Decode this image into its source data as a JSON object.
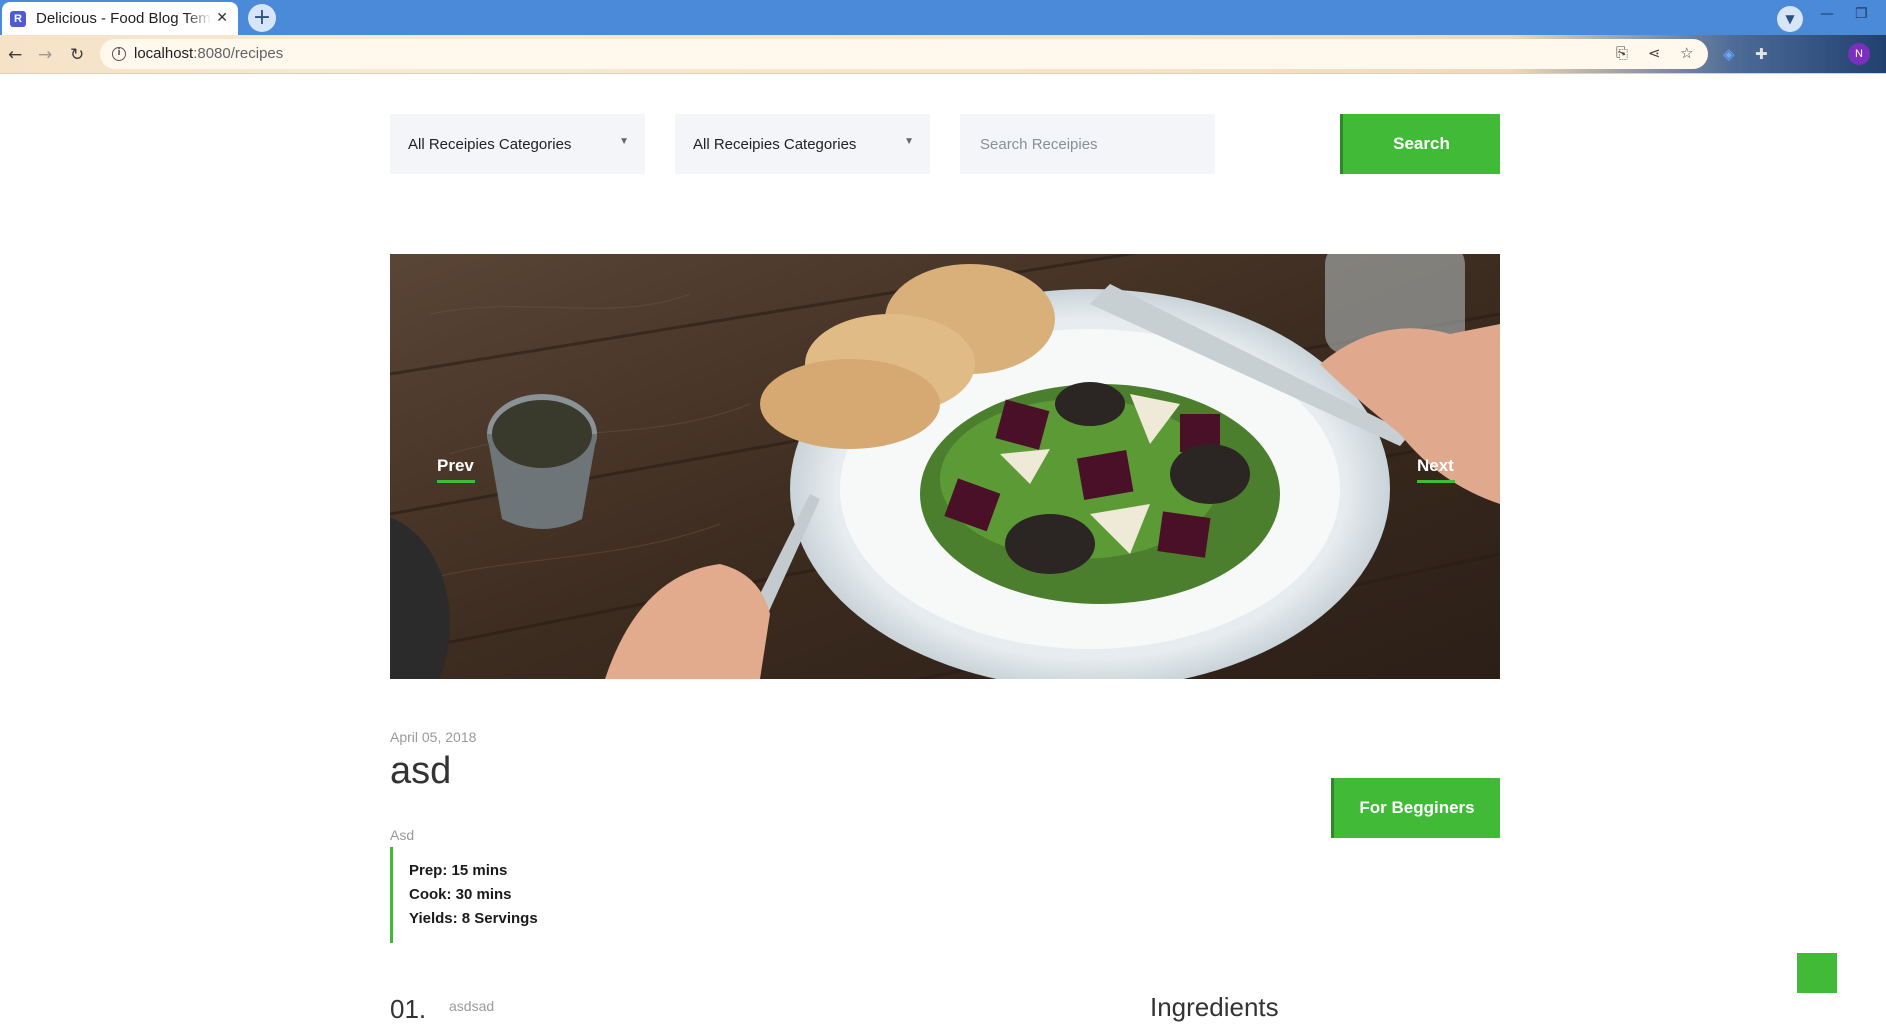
{
  "browser": {
    "tab_title": "Delicious - Food Blog Template | Home",
    "tab_close": "✕",
    "new_tab": "+",
    "url_host": "localhost",
    "url_path": ":8080/recipes",
    "profile_initial": "N",
    "icons": [
      "back-icon",
      "forward-icon",
      "reload-icon",
      "info-icon",
      "translate-icon",
      "share-icon",
      "star-icon",
      "extension-icon",
      "puzzle-icon",
      "tab-search-icon"
    ]
  },
  "filters": {
    "category_1": "All Receipies Categories",
    "category_2": "All Receipies Categories",
    "search_placeholder": "Search Receipies",
    "search_button": "Search"
  },
  "hero": {
    "prev_label": "Prev",
    "next_label": "Next"
  },
  "post": {
    "date": "April 05, 2018",
    "title": "asd",
    "subtitle": "Asd",
    "prep": "Prep: 15 mins",
    "cook": "Cook: 30 mins",
    "yields": "Yields: 8 Servings",
    "level_button": "For Begginers"
  },
  "steps": [
    {
      "number": "01.",
      "text": "asdsad"
    }
  ],
  "ingredients_title": "Ingredients",
  "colors": {
    "accent": "#40ba37",
    "tabbar": "#4a8ad9"
  }
}
